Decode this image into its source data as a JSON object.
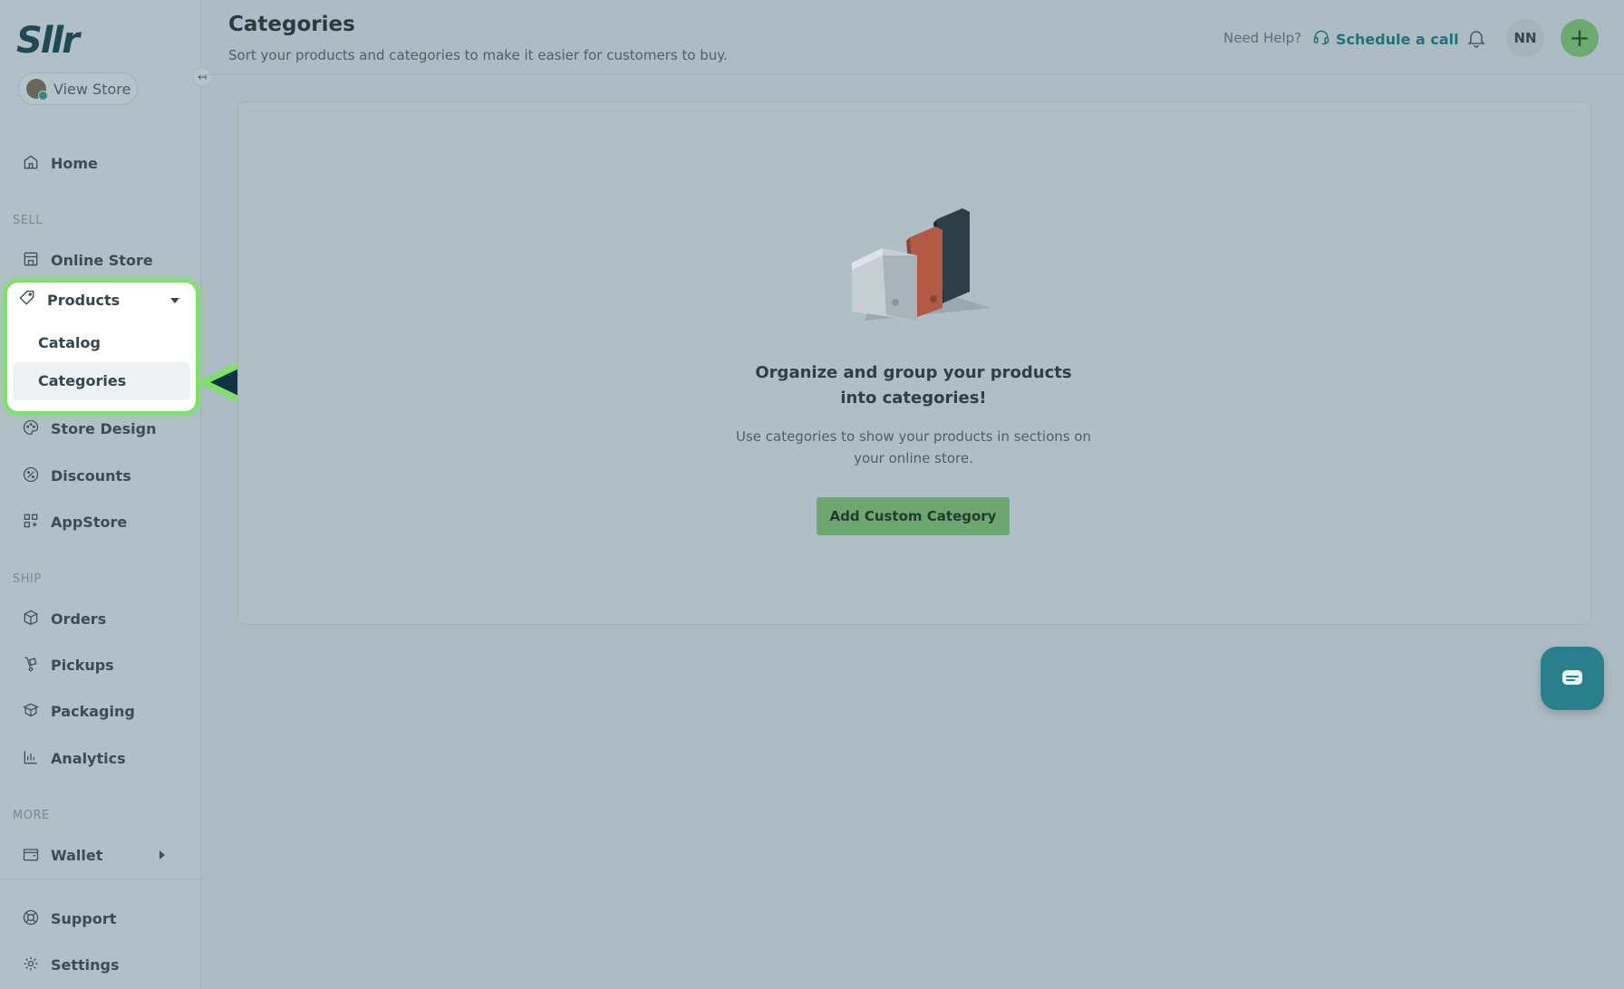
{
  "brand": {
    "logo_text": "Sllr"
  },
  "sidebar": {
    "view_store_label": "View Store",
    "collapse_icon": "↤",
    "home": "Home",
    "section_sell": "SELL",
    "online_store": "Online Store",
    "products": "Products",
    "products_sub": [
      "Catalog",
      "Categories"
    ],
    "store_design": "Store Design",
    "discounts": "Discounts",
    "appstore": "AppStore",
    "section_ship": "SHIP",
    "orders": "Orders",
    "pickups": "Pickups",
    "packaging": "Packaging",
    "analytics": "Analytics",
    "section_more": "MORE",
    "wallet": "Wallet",
    "support": "Support",
    "settings": "Settings"
  },
  "header": {
    "title": "Categories",
    "subtitle": "Sort your products and categories to make it easier for customers to buy.",
    "need_help": "Need Help?",
    "schedule_call": "Schedule a call",
    "user_initials": "NN",
    "plus_symbol": "+"
  },
  "empty_state": {
    "title": "Organize and group your products into categories!",
    "description": "Use categories to show your products in sections on your online store.",
    "button_label": "Add Custom Category"
  },
  "colors": {
    "highlight": "#7fe06c",
    "accent_green": "#6ca772",
    "brand_teal": "#22707a",
    "arrow_fill": "#0f3342"
  }
}
